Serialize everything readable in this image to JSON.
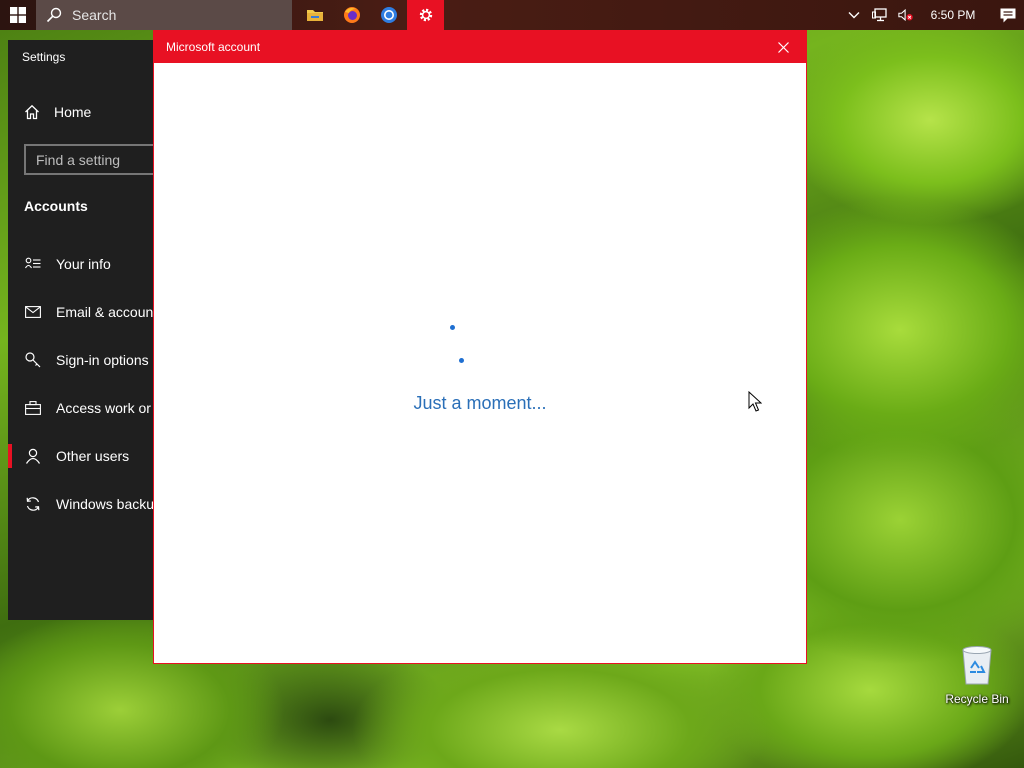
{
  "taskbar": {
    "search_placeholder": "Search",
    "pinned_apps": [
      "file-explorer-icon",
      "firefox-icon",
      "chrome-icon",
      "settings-icon"
    ],
    "clock": "6:50 PM"
  },
  "settings": {
    "window_title": "Settings",
    "home_label": "Home",
    "search_placeholder": "Find a setting",
    "section_heading": "Accounts",
    "items": [
      {
        "label": "Your info",
        "icon": "person-list-icon"
      },
      {
        "label": "Email & accounts",
        "icon": "mail-icon"
      },
      {
        "label": "Sign-in options",
        "icon": "key-icon"
      },
      {
        "label": "Access work or school",
        "icon": "briefcase-icon"
      },
      {
        "label": "Other users",
        "icon": "person-icon",
        "selected": true
      },
      {
        "label": "Windows backup",
        "icon": "sync-icon"
      }
    ]
  },
  "dialog": {
    "title": "Microsoft account",
    "loading_text": "Just a moment..."
  },
  "desktop": {
    "recycle_bin_label": "Recycle Bin"
  },
  "colors": {
    "accent": "#e81123",
    "spinner": "#1f6fd1",
    "link_text": "#2a6fb8",
    "settings_bg": "#1f1f1f"
  }
}
